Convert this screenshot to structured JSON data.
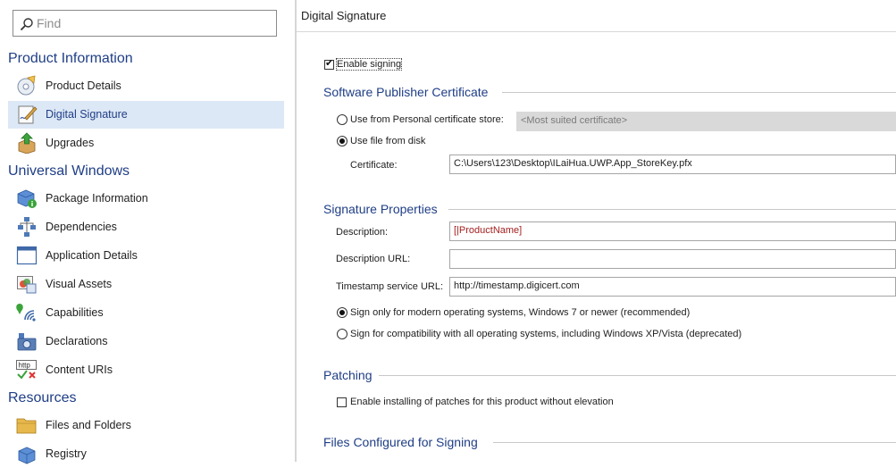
{
  "search": {
    "placeholder": "Find"
  },
  "nav": {
    "groups": [
      {
        "title": "Product Information",
        "items": [
          {
            "label": "Product Details"
          },
          {
            "label": "Digital Signature"
          },
          {
            "label": "Upgrades"
          }
        ]
      },
      {
        "title": "Universal Windows",
        "items": [
          {
            "label": "Package Information"
          },
          {
            "label": "Dependencies"
          },
          {
            "label": "Application Details"
          },
          {
            "label": "Visual Assets"
          },
          {
            "label": "Capabilities"
          },
          {
            "label": "Declarations"
          },
          {
            "label": "Content URIs"
          }
        ]
      },
      {
        "title": "Resources",
        "items": [
          {
            "label": "Files and Folders"
          },
          {
            "label": "Registry"
          }
        ]
      }
    ],
    "selected": "Digital Signature",
    "http_icon_text": "http"
  },
  "panel": {
    "title": "Digital Signature",
    "enable_signing": {
      "label": "Enable signing",
      "checked": true
    },
    "certificate_section": {
      "title": "Software Publisher Certificate",
      "option_store": {
        "label": "Use from Personal certificate store:",
        "selected": false
      },
      "store_value": "<Most suited certificate>",
      "option_file": {
        "label": "Use file from disk",
        "selected": true
      },
      "certificate_label": "Certificate:",
      "certificate_value": "C:\\Users\\123\\Desktop\\ILaiHua.UWP.App_StoreKey.pfx"
    },
    "signature_section": {
      "title": "Signature Properties",
      "description_label": "Description:",
      "description_value": "[|ProductName]",
      "description_url_label": "Description URL:",
      "description_url_value": "",
      "timestamp_label": "Timestamp service URL:",
      "timestamp_value": "http://timestamp.digicert.com",
      "option_modern": {
        "label": "Sign only for modern operating systems, Windows 7 or newer (recommended)",
        "selected": true
      },
      "option_compat": {
        "label": "Sign for compatibility with all operating systems, including Windows XP/Vista (deprecated)",
        "selected": false
      }
    },
    "patching_section": {
      "title": "Patching",
      "patch_option": {
        "label": "Enable installing of patches for this product without elevation",
        "checked": false
      }
    },
    "files_section": {
      "title": "Files Configured for Signing"
    }
  },
  "colors": {
    "accent": "#1f3e86",
    "selection": "#dde8f6",
    "disabled_field": "#d9d9d9",
    "formula_text": "#a42020"
  }
}
